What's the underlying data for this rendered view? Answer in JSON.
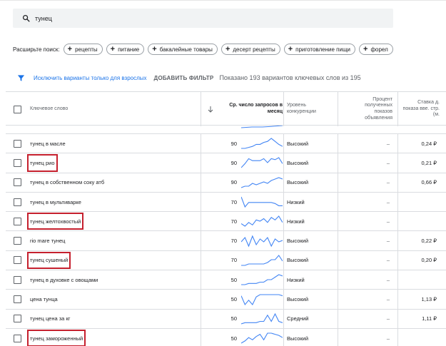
{
  "search": {
    "value": "тунец",
    "icon": "search-icon"
  },
  "expand": {
    "label": "Расширьте поиск:",
    "chips": [
      "рецепты",
      "питание",
      "бакалейные товары",
      "десерт рецепты",
      "приготовление пищи",
      "форел"
    ]
  },
  "filterbar": {
    "exclude_link": "Исключить варианты только для взрослых",
    "add_filter": "ДОБАВИТЬ ФИЛЬТР",
    "shown": "Показано 193 вариантов ключевых слов из 195"
  },
  "table": {
    "headers": {
      "keyword": "Ключевое слово",
      "volume": "Ср. число запросов в месяц",
      "competition": "Уровень конкуренции",
      "impression_share": "Процент полученных показов объявления",
      "bid": "Ставка д. показа вве. стр. (м."
    },
    "rows": [
      {
        "keyword": "тунец в масле",
        "volume": "90",
        "competition": "Высокий",
        "share": "–",
        "bid": "0,24 ₽",
        "trend": [
          5,
          5,
          6,
          7,
          9,
          9,
          11,
          12,
          15,
          12,
          9,
          7
        ],
        "highlight": false
      },
      {
        "keyword": "тунец рио",
        "volume": "90",
        "competition": "Высокий",
        "share": "–",
        "bid": "0,21 ₽",
        "trend": [
          4,
          8,
          13,
          11,
          11,
          11,
          13,
          9,
          13,
          12,
          14,
          8
        ],
        "highlight": true
      },
      {
        "keyword": "тунец в собственном соку атб",
        "volume": "90",
        "competition": "Высокий",
        "share": "–",
        "bid": "0,66 ₽",
        "trend": [
          6,
          7,
          7,
          9,
          8,
          9,
          10,
          9,
          11,
          12,
          13,
          12
        ],
        "highlight": false
      },
      {
        "keyword": "тунец в мультиварке",
        "volume": "70",
        "competition": "Низкий",
        "share": "–",
        "bid": "",
        "trend": [
          13,
          4,
          8,
          8,
          8,
          8,
          8,
          8,
          8,
          7,
          5,
          5
        ],
        "highlight": false
      },
      {
        "keyword": "тунец желтохвостый",
        "volume": "70",
        "competition": "Низкий",
        "share": "–",
        "bid": "",
        "trend": [
          8,
          6,
          9,
          7,
          11,
          10,
          12,
          9,
          13,
          11,
          14,
          9
        ],
        "highlight": true
      },
      {
        "keyword": "rio mare тунец",
        "volume": "70",
        "competition": "Высокий",
        "share": "–",
        "bid": "0,22 ₽",
        "trend": [
          9,
          12,
          6,
          13,
          7,
          11,
          9,
          12,
          6,
          11,
          9,
          10
        ],
        "highlight": false
      },
      {
        "keyword": "тунец сушеный",
        "volume": "70",
        "competition": "Высокий",
        "share": "–",
        "bid": "0,20 ₽",
        "trend": [
          6,
          6,
          7,
          7,
          7,
          7,
          7,
          8,
          10,
          10,
          13,
          9
        ],
        "highlight": true
      },
      {
        "keyword": "тунец в духовке с овощами",
        "volume": "50",
        "competition": "Низкий",
        "share": "–",
        "bid": "",
        "trend": [
          5,
          5,
          6,
          6,
          6,
          7,
          7,
          9,
          9,
          11,
          13,
          12
        ],
        "highlight": false
      },
      {
        "keyword": "цена тунца",
        "volume": "50",
        "competition": "Высокий",
        "share": "–",
        "bid": "1,13 ₽",
        "trend": [
          13,
          5,
          9,
          5,
          12,
          14,
          14,
          14,
          14,
          14,
          14,
          13
        ],
        "highlight": false
      },
      {
        "keyword": "тунец цена за кг",
        "volume": "50",
        "competition": "Средний",
        "share": "–",
        "bid": "1,11 ₽",
        "trend": [
          5,
          6,
          6,
          6,
          6,
          7,
          7,
          12,
          7,
          13,
          7,
          6
        ],
        "highlight": false
      },
      {
        "keyword": "тунец замороженный",
        "volume": "50",
        "competition": "Высокий",
        "share": "–",
        "bid": "",
        "trend": [
          4,
          6,
          9,
          7,
          10,
          12,
          7,
          13,
          13,
          12,
          11,
          9
        ],
        "highlight": true
      }
    ]
  },
  "colors": {
    "accent": "#1a73e8",
    "highlight": "#c5202e",
    "sparkline": "#4285f4"
  }
}
